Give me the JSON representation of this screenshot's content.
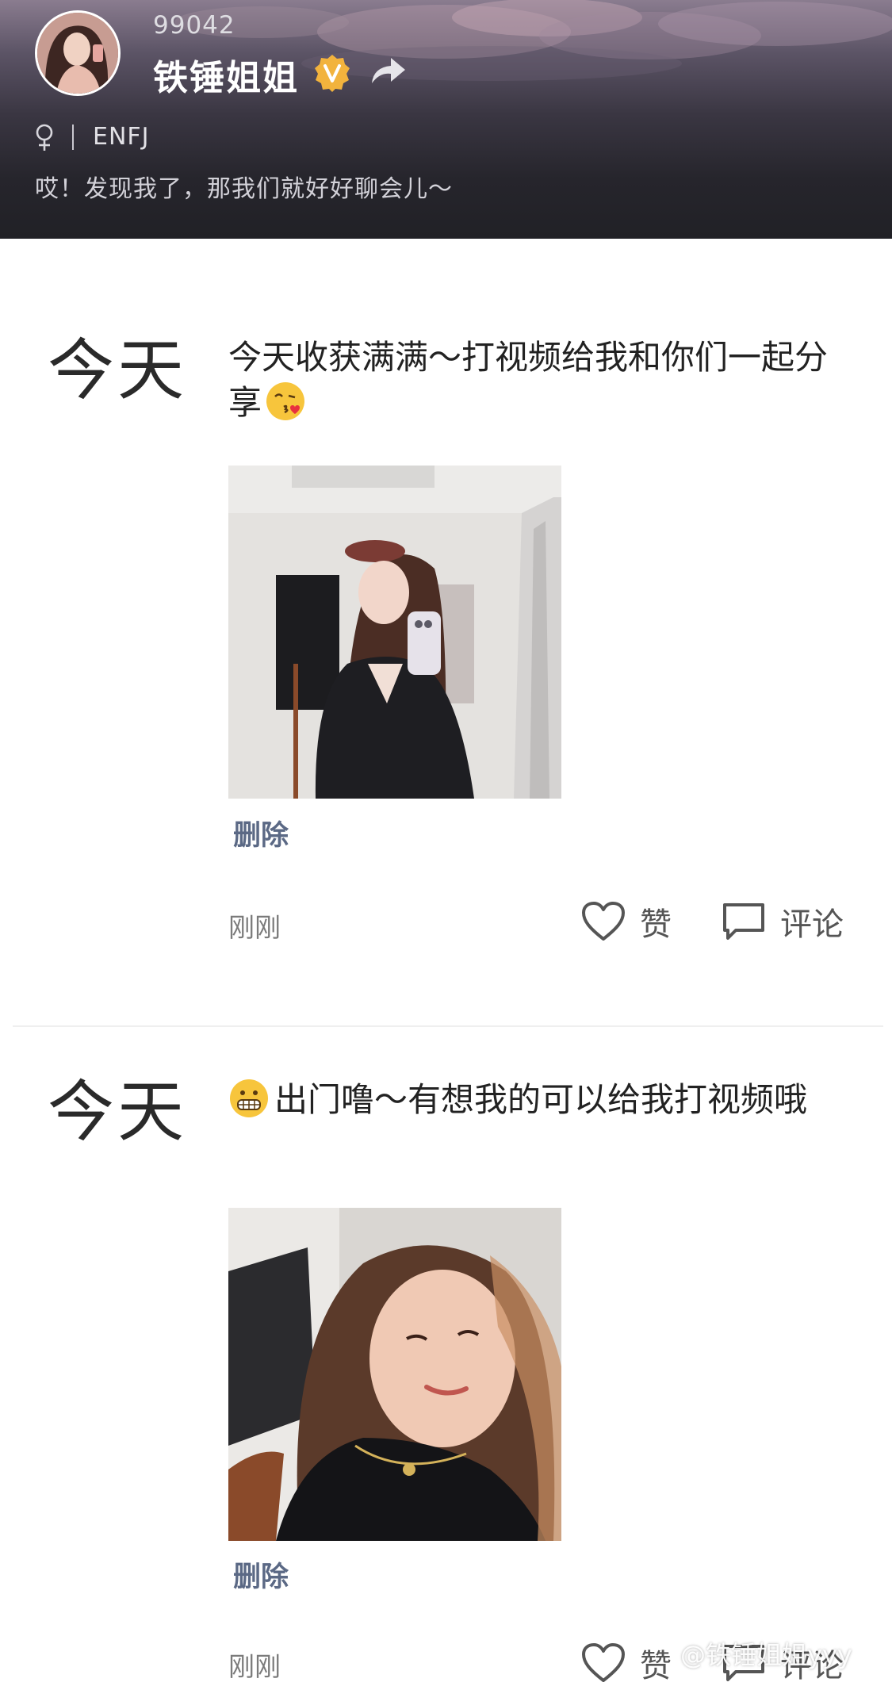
{
  "profile": {
    "user_id": "99042",
    "name": "铁锤姐姐",
    "mbti": "ENFJ",
    "bio": "哎！发现我了，那我们就好好聊会儿～"
  },
  "posts": [
    {
      "date": "今天",
      "text": "今天收获满满～打视频给我和你们一起分享",
      "emoji": "kissing-heart-emoji",
      "delete_label": "删除",
      "timestamp": "刚刚",
      "like_label": "赞",
      "comment_label": "评论"
    },
    {
      "date": "今天",
      "text": "出门噜～有想我的可以给我打视频哦",
      "emoji": "grimacing-emoji",
      "delete_label": "删除",
      "timestamp": "刚刚",
      "like_label": "赞",
      "comment_label": "评论"
    }
  ],
  "watermark": "@铁锤姐姐yyy",
  "colors": {
    "header_bg": "#26252c",
    "vip_badge": "#f2b33d",
    "delete_link": "#5b6985"
  }
}
